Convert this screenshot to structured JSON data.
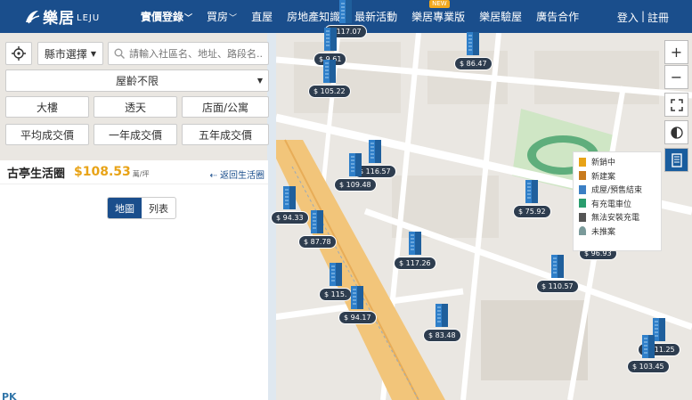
{
  "nav": {
    "logo_cn": "樂居",
    "logo_en": "LEJU",
    "items": [
      {
        "label": "實價登錄",
        "caret": true,
        "active": true
      },
      {
        "label": "買房",
        "caret": true
      },
      {
        "label": "直屋"
      },
      {
        "label": "房地產知識"
      },
      {
        "label": "最新活動"
      },
      {
        "label": "樂居專業版",
        "badge": "NEW"
      },
      {
        "label": "樂居驗屋"
      },
      {
        "label": "廣告合作"
      }
    ],
    "login": "登入",
    "separator": "|",
    "register": "註冊"
  },
  "filters": {
    "city_select": "縣市選擇",
    "search_placeholder": "請輸入社區名、地址、路段名...",
    "age_select": "屋齡不限",
    "type_buttons": [
      "大樓",
      "透天",
      "店面/公寓"
    ],
    "period_buttons": [
      "平均成交價",
      "一年成交價",
      "五年成交價"
    ]
  },
  "result": {
    "title": "古亭生活圈",
    "price": "$108.53",
    "unit": "萬/坪",
    "back": "返回生活圈",
    "tab_map": "地圖",
    "tab_list": "列表",
    "watermark": "PK"
  },
  "pins": [
    {
      "price": "$ 117.07"
    },
    {
      "price": "$ 9.61"
    },
    {
      "price": "$ 105.22"
    },
    {
      "price": "$ 86.47"
    },
    {
      "price": "$ 116.57"
    },
    {
      "price": "$ 109.48"
    },
    {
      "price": "$ 94.33"
    },
    {
      "price": "$ 87.78"
    },
    {
      "price": "$ 75.92"
    },
    {
      "price": "$ 117.26"
    },
    {
      "price": "$ 96.93"
    },
    {
      "price": "$ 110.57"
    },
    {
      "price": "$ 115."
    },
    {
      "price": "$ 94.17"
    },
    {
      "price": "$ 83.48"
    },
    {
      "price": "$ 111.25"
    },
    {
      "price": "$ 103.45"
    }
  ],
  "legend": [
    {
      "label": "新銷中",
      "color": "#e8a317"
    },
    {
      "label": "新建案",
      "color": "#c87a1c"
    },
    {
      "label": "成屋/預售結束",
      "color": "#3b7fc4"
    },
    {
      "label": "有充電車位",
      "color": "#2a9d6e"
    },
    {
      "label": "無法安裝充電",
      "color": "#555555"
    },
    {
      "label": "未推案",
      "color": "#7a9a9a"
    }
  ],
  "controls": [
    "plus-icon",
    "minus-icon",
    "fullscreen-icon",
    "contrast-icon",
    "layers-icon"
  ],
  "colors": {
    "brand": "#1a4e8c",
    "price": "#e8a317",
    "road_main": "#f2c57a",
    "park": "#cfe6c5"
  }
}
